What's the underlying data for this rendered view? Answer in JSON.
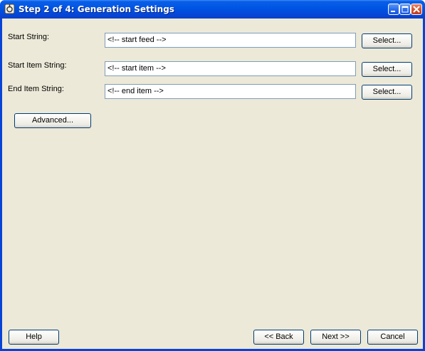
{
  "window": {
    "title": "Step 2 of 4: Generation Settings",
    "icons": {
      "app": "app-icon",
      "minimize": "minimize-icon",
      "maximize": "maximize-icon",
      "close": "close-icon"
    }
  },
  "fields": [
    {
      "label": "Start String:",
      "value": "<!-- start feed -->",
      "button": "Select..."
    },
    {
      "label": "Start Item String:",
      "value": "<!-- start item -->",
      "button": "Select..."
    },
    {
      "label": "End Item String:",
      "value": "<!-- end item -->",
      "button": "Select..."
    }
  ],
  "advanced_button": "Advanced...",
  "footer": {
    "help": "Help",
    "back": "<< Back",
    "next": "Next >>",
    "cancel": "Cancel"
  },
  "colors": {
    "titlebar": "#0054e3",
    "client_background": "#ece9d8",
    "field_border": "#7f9db9",
    "button_border": "#003c74"
  }
}
